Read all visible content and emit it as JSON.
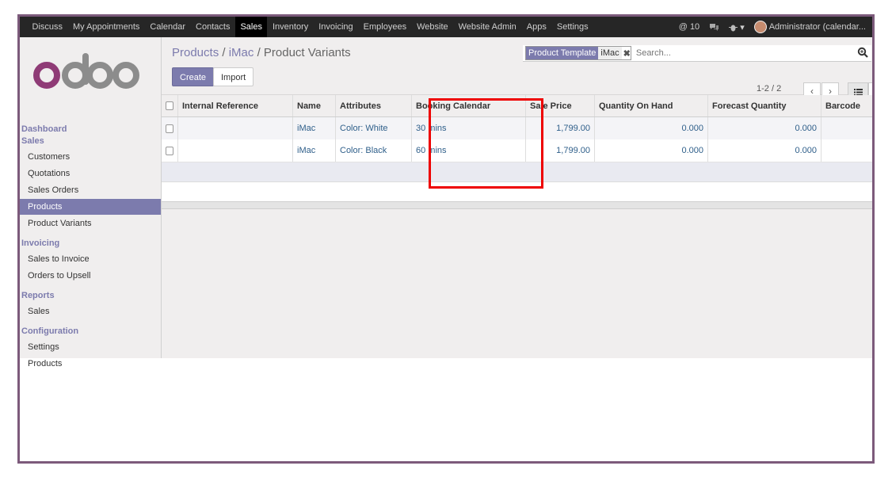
{
  "nav": {
    "menu": [
      "Discuss",
      "My Appointments",
      "Calendar",
      "Contacts",
      "Sales",
      "Inventory",
      "Invoicing",
      "Employees",
      "Website",
      "Website Admin",
      "Apps",
      "Settings"
    ],
    "active": "Sales",
    "messages_count": "10",
    "user": "Administrator (calendar..."
  },
  "logo": "odoo",
  "sidebar": {
    "dashboard": "Dashboard",
    "sales_section": "Sales",
    "sales_items": [
      "Customers",
      "Quotations",
      "Sales Orders",
      "Products",
      "Product Variants"
    ],
    "invoicing_section": "Invoicing",
    "invoicing_items": [
      "Sales to Invoice",
      "Orders to Upsell"
    ],
    "reports_section": "Reports",
    "reports_items": [
      "Sales"
    ],
    "configuration_section": "Configuration",
    "configuration_items": [
      "Settings",
      "Products"
    ]
  },
  "breadcrumb": {
    "crumb1": "Products",
    "crumb2": "iMac",
    "current": "Product Variants"
  },
  "buttons": {
    "create": "Create",
    "import": "Import"
  },
  "search": {
    "facet_label": "Product Template",
    "facet_value": "iMac",
    "placeholder": "Search..."
  },
  "pager": "1-2 / 2",
  "table": {
    "headers": [
      "Internal Reference",
      "Name",
      "Attributes",
      "Booking Calendar",
      "Sale Price",
      "Quantity On Hand",
      "Forecast Quantity",
      "Barcode"
    ],
    "rows": [
      {
        "ref": "",
        "name": "iMac",
        "attributes": "Color: White",
        "booking": "30 mins",
        "price": "1,799.00",
        "qty": "0.000",
        "forecast": "0.000",
        "barcode": ""
      },
      {
        "ref": "",
        "name": "iMac",
        "attributes": "Color: Black",
        "booking": "60 mins",
        "price": "1,799.00",
        "qty": "0.000",
        "forecast": "0.000",
        "barcode": ""
      }
    ]
  },
  "colors": {
    "brand": "#7c7bad",
    "topbar": "#262626",
    "frame": "#7c5a7b",
    "highlight": "#ee0000"
  }
}
